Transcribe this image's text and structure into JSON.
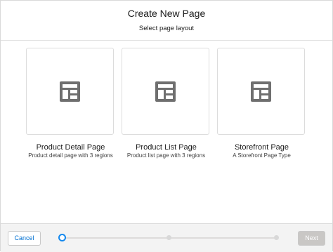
{
  "header": {
    "title": "Create New Page",
    "subtitle": "Select page layout"
  },
  "layouts": [
    {
      "icon": "layout-icon",
      "title": "Product Detail Page",
      "description": "Product detail page with 3 regions"
    },
    {
      "icon": "layout-icon",
      "title": "Product List Page",
      "description": "Product list page with 3 regions"
    },
    {
      "icon": "layout-icon",
      "title": "Storefront Page",
      "description": "A Storefront Page Type"
    }
  ],
  "footer": {
    "cancel_label": "Cancel",
    "next_label": "Next",
    "progress": {
      "current_step": 1,
      "total_steps": 3
    }
  },
  "colors": {
    "accent": "#1589ee",
    "link": "#0070d2",
    "icon": "#6f6f6f",
    "disabled_button": "#c9c7c5"
  }
}
